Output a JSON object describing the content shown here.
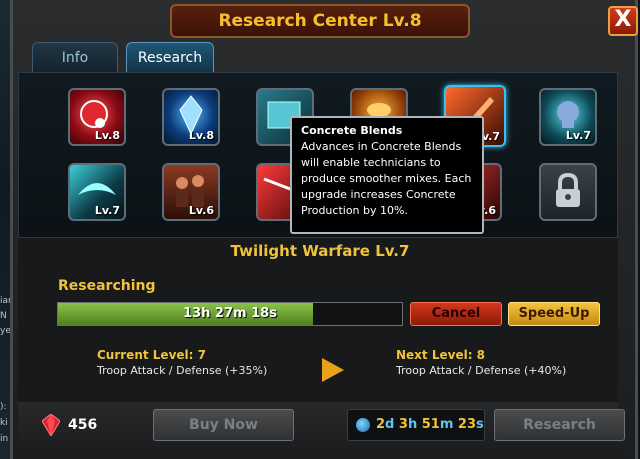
{
  "window": {
    "title": "Research Center Lv.8",
    "close_label": "X"
  },
  "tabs": [
    {
      "label": "Info",
      "active": false
    },
    {
      "label": "Research",
      "active": true
    }
  ],
  "research_items": [
    {
      "row": 1,
      "icon": "red-orb-icon",
      "level": "Lv.8"
    },
    {
      "row": 1,
      "icon": "blue-crystal-icon",
      "level": "Lv.8"
    },
    {
      "row": 1,
      "icon": "cyan-machine-icon",
      "level": ""
    },
    {
      "row": 1,
      "icon": "orange-furnace-icon",
      "level": ""
    },
    {
      "row": 1,
      "icon": "orange-blade-icon",
      "level": "Lv.7",
      "selected": true
    },
    {
      "row": 1,
      "icon": "cyan-skull-icon",
      "level": "Lv.7"
    },
    {
      "row": 2,
      "icon": "cyan-wing-icon",
      "level": "Lv.7"
    },
    {
      "row": 2,
      "icon": "soldiers-icon",
      "level": "Lv.6"
    },
    {
      "row": 2,
      "icon": "red-laser-icon",
      "level": ""
    },
    {
      "row": 2,
      "icon": "red-unit-icon",
      "level": "Lv.6"
    },
    {
      "row": 2,
      "icon": "lock-icon",
      "level": "",
      "locked": true
    }
  ],
  "tooltip": {
    "title": "Concrete Blends",
    "body": "Advances in Concrete Blends will enable technicians to produce smoother mixes. Each upgrade increases Concrete Production by 10%."
  },
  "selected_item": {
    "name": "Twilight Warfare Lv.7"
  },
  "research_status": {
    "label": "Researching",
    "time_remaining": "13h 27m 18s",
    "progress_fraction": 0.74
  },
  "buttons": {
    "cancel": "Cancel",
    "speed_up": "Speed-Up",
    "buy_now": "Buy Now",
    "research": "Research"
  },
  "current_level": {
    "heading": "Current Level: 7",
    "effect": "Troop Attack / Defense (+35%)"
  },
  "next_level": {
    "heading": "Next Level: 8",
    "effect": "Troop Attack / Defense (+40%)"
  },
  "gems": {
    "count": "456"
  },
  "timer": [
    {
      "num": "2",
      "unit": "d"
    },
    {
      "num": "3",
      "unit": "h"
    },
    {
      "num": "51",
      "unit": "m"
    },
    {
      "num": "23",
      "unit": "s"
    }
  ],
  "background_fragments": [
    "ian",
    "N",
    "ye",
    "):",
    "ki",
    "in"
  ],
  "colors": {
    "accent_gold": "#f0c33a",
    "cancel_red": "#d2381c",
    "speedup_gold": "#f4c43c",
    "progress_green": "#6fa83a",
    "selected_border": "#3ac0f0"
  }
}
